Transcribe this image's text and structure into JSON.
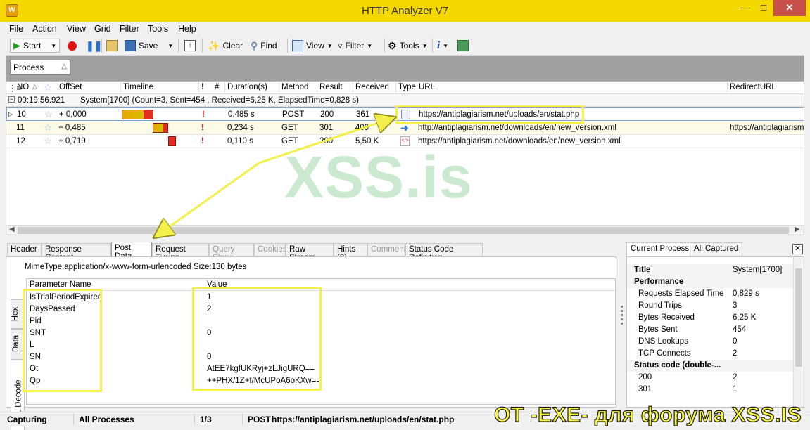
{
  "window": {
    "title": "HTTP Analyzer V7"
  },
  "colors": {
    "titlebar": "#f5d800",
    "highlight": "#f3f04a",
    "watermark": "#9fd8a8",
    "close": "#c7504b",
    "bar_orange": "#e8a500",
    "bar_red": "#e52d1f"
  },
  "menu": [
    "File",
    "Action",
    "View",
    "Grid",
    "Filter",
    "Tools",
    "Help"
  ],
  "toolbar": {
    "start": "Start",
    "save": "Save",
    "clear": "Clear",
    "find": "Find",
    "view": "View",
    "filter": "Filter",
    "tools": "Tools"
  },
  "groupbar": {
    "chip": "Process"
  },
  "grid": {
    "columns": [
      "NO",
      "OffSet",
      "Timeline",
      "!",
      "#",
      "Duration(s)",
      "Method",
      "Result",
      "Received",
      "Type",
      "URL",
      "RedirectURL"
    ],
    "group_row": {
      "time": "00:19:56.921",
      "text": "System[1700]  (Count=3, Sent=454 , Received=6,25 K, ElapsedTime=0,828 s)"
    },
    "rows": [
      {
        "no": "10",
        "offset": "+ 0,000",
        "flag": "!",
        "duration": "0,485 s",
        "method": "POST",
        "result": "200",
        "received": "361",
        "url": "https://antiplagiarism.net/uploads/en/stat.php",
        "redirect": "",
        "timeline": [
          0.0,
          0.42
        ],
        "type_icon": "document-icon"
      },
      {
        "no": "11",
        "offset": "+ 0,485",
        "flag": "!",
        "duration": "0,234 s",
        "method": "GET",
        "result": "301",
        "received": "409",
        "url": "http://antiplagiarism.net/downloads/en/new_version.xml",
        "redirect": "https://antiplagiarism...",
        "timeline": [
          0.42,
          0.62
        ],
        "type_icon": "redirect-arrow-icon"
      },
      {
        "no": "12",
        "offset": "+ 0,719",
        "flag": "!",
        "duration": "0,110 s",
        "method": "GET",
        "result": "200",
        "received": "5,50 K",
        "url": "https://antiplagiarism.net/downloads/en/new_version.xml",
        "redirect": "",
        "timeline": [
          0.62,
          0.72
        ],
        "type_icon": "xml-file-icon"
      }
    ]
  },
  "watermark": "XSS.is",
  "lower_tabs": [
    {
      "label": "Header",
      "state": "normal"
    },
    {
      "label": "Response Content",
      "state": "normal"
    },
    {
      "label": "Post Data",
      "state": "active"
    },
    {
      "label": "Request Timing",
      "state": "normal"
    },
    {
      "label": "Query String",
      "state": "disabled"
    },
    {
      "label": "Cookies",
      "state": "disabled"
    },
    {
      "label": "Raw Stream",
      "state": "normal"
    },
    {
      "label": "Hints (3)",
      "state": "normal"
    },
    {
      "label": "Comment",
      "state": "disabled"
    },
    {
      "label": "Status Code Definition",
      "state": "normal"
    }
  ],
  "post": {
    "mimetype": "MimeType:application/x-www-form-urlencoded",
    "size": "Size:130 bytes",
    "col_name": "Parameter Name",
    "col_value": "Value",
    "params": [
      {
        "name": "IsTrialPeriodExpired",
        "value": "1"
      },
      {
        "name": "DaysPassed",
        "value": "2"
      },
      {
        "name": "Pid",
        "value": ""
      },
      {
        "name": "SNT",
        "value": "0"
      },
      {
        "name": "L",
        "value": ""
      },
      {
        "name": "SN",
        "value": "0"
      },
      {
        "name": "Ot",
        "value": "AtEE7kgfUKRyj+zLJigURQ=="
      },
      {
        "name": "Qp",
        "value": "++PHX/1Z+f/McUPoA6oKXw=="
      }
    ]
  },
  "side_tabs": [
    "Hex",
    "Data",
    "URL Decode"
  ],
  "right_tabs": [
    "Current Process",
    "All Captured"
  ],
  "right_panel": {
    "rows": [
      {
        "kind": "cat",
        "key": "Title",
        "value": "System[1700]"
      },
      {
        "kind": "cat",
        "key": "Performance",
        "value": ""
      },
      {
        "kind": "item",
        "key": "Requests Elapsed Time",
        "value": "0,829 s"
      },
      {
        "kind": "item",
        "key": "Round Trips",
        "value": "3"
      },
      {
        "kind": "item",
        "key": "Bytes Received",
        "value": "6,25 K"
      },
      {
        "kind": "item",
        "key": "Bytes Sent",
        "value": "454"
      },
      {
        "kind": "item",
        "key": "DNS Lookups",
        "value": "0"
      },
      {
        "kind": "item",
        "key": "TCP Connects",
        "value": "2"
      },
      {
        "kind": "cat",
        "key": "Status code (double-...",
        "value": ""
      },
      {
        "kind": "item",
        "key": "200",
        "value": "2"
      },
      {
        "kind": "item",
        "key": "301",
        "value": "1"
      }
    ]
  },
  "statusbar": {
    "state": "Capturing",
    "filter": "All Processes",
    "position": "1/3",
    "method": "POST",
    "url": "https://antiplagiarism.net/uploads/en/stat.php"
  },
  "overlay_caption": "ОТ -EXE- для форума XSS.IS"
}
